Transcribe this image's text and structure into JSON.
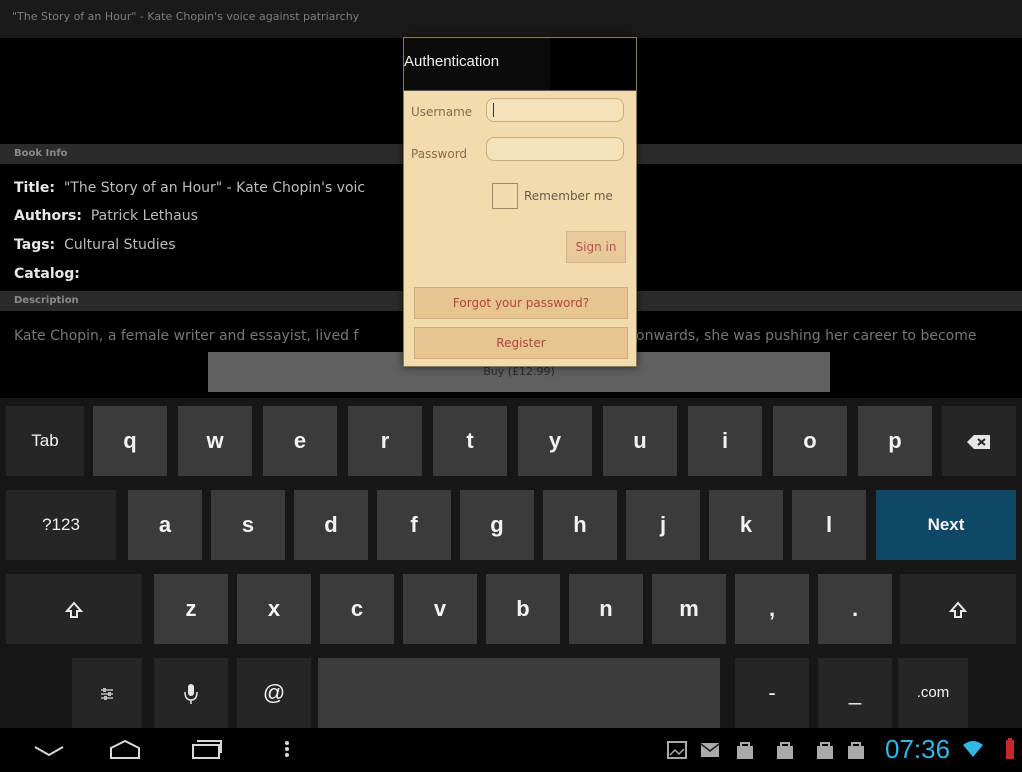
{
  "window": {
    "title": "\"The Story of an Hour\" - Kate Chopin's voice against patriarchy"
  },
  "book_info": {
    "header": "Book Info",
    "title_label": "Title:",
    "title_value": "\"The Story of an Hour\" - Kate Chopin's voic",
    "authors_label": "Authors:",
    "authors_value": "Patrick Lethaus",
    "tags_label": "Tags:",
    "tags_value": "Cultural Studies",
    "catalog_label": "Catalog:"
  },
  "description": {
    "header": "Description",
    "text_left": "Kate Chopin, a female writer and essayist, lived f",
    "text_right": "onwards, she was pushing her career to become"
  },
  "buy_button": "Buy (£12.99)",
  "dialog": {
    "title": "Authentication",
    "username_label": "Username",
    "password_label": "Password",
    "remember_label": "Remember me",
    "signin_label": "Sign in",
    "forgot_label": "Forgot your password?",
    "register_label": "Register"
  },
  "keyboard": {
    "row1": [
      "q",
      "w",
      "e",
      "r",
      "t",
      "y",
      "u",
      "i",
      "o",
      "p"
    ],
    "row2": [
      "a",
      "s",
      "d",
      "f",
      "g",
      "h",
      "j",
      "k",
      "l"
    ],
    "row3": [
      "z",
      "x",
      "c",
      "v",
      "b",
      "n",
      "m",
      ",",
      "."
    ],
    "tab": "Tab",
    "sym": "?123",
    "next": "Next",
    "at": "@",
    "dash": "-",
    "underscore": "_",
    "dotcom": ".com"
  },
  "status": {
    "time": "07:36"
  },
  "colors": {
    "accent": "#33b5e5",
    "next_key": "#0e4866",
    "dialog_bg": "#f2dcad"
  }
}
